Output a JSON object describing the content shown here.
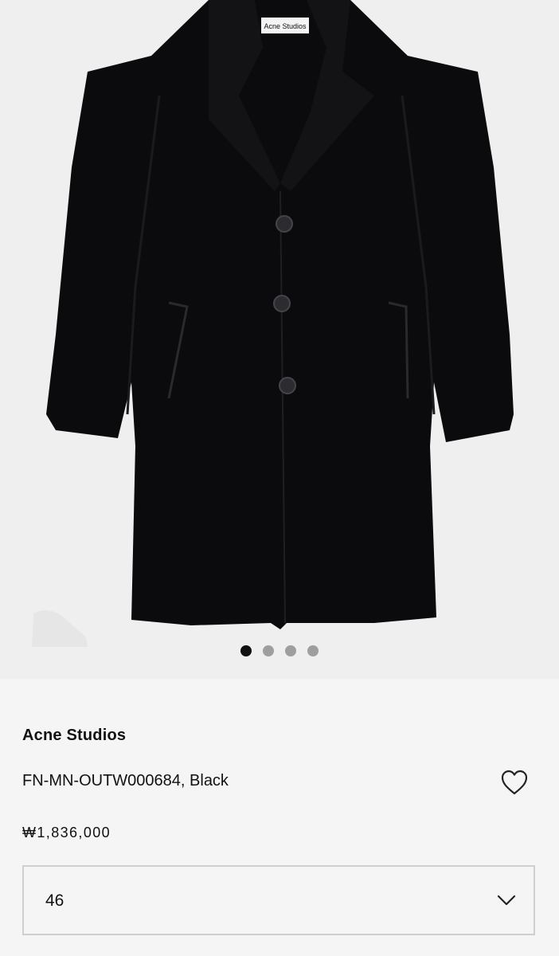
{
  "gallery": {
    "image_alt": "Black wool coat product photo",
    "label_text": "Acne Studios",
    "dots": [
      {
        "state": "active"
      },
      {
        "state": "inactive"
      },
      {
        "state": "inactive"
      },
      {
        "state": "inactive"
      }
    ]
  },
  "product": {
    "brand": "Acne Studios",
    "name": "FN-MN-OUTW000684, Black",
    "price": "₩1,836,000",
    "wishlist_icon": "heart-outline-icon"
  },
  "size_select": {
    "selected_value": "46",
    "icon": "chevron-down-icon"
  },
  "colors": {
    "hero_background": "#efefef",
    "page_background": "#f5f5f5",
    "coat": "#0b0b0d",
    "text": "#111111",
    "dot_inactive": "#9e9e9e",
    "border": "#cfcfcf"
  }
}
